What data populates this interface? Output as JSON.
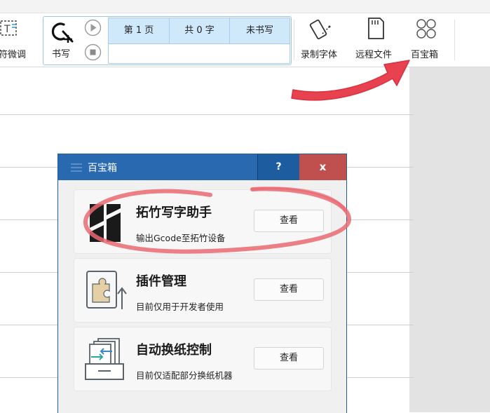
{
  "toolbar": {
    "fine_tune_label": "符微调",
    "write_label": "书写",
    "info": {
      "page": "第 1 页",
      "total": "共 0 字",
      "status": "未书写"
    },
    "record_font_label": "录制字体",
    "remote_file_label": "远程文件",
    "toolbox_label": "百宝箱"
  },
  "dialog": {
    "title": "百宝箱",
    "help_label": "?",
    "close_label": "x",
    "cards": [
      {
        "title": "拓竹写字助手",
        "desc": "输出Gcode至拓竹设备",
        "button": "查看"
      },
      {
        "title": "插件管理",
        "desc": "目前仅用于开发者使用",
        "button": "查看"
      },
      {
        "title": "自动换纸控制",
        "desc": "目前仅适配部分换纸机器",
        "button": "查看"
      }
    ]
  },
  "colors": {
    "annotation_red": "#e8414f",
    "title_bar": "#2869b0",
    "close_button": "#c0504d",
    "info_row_bg": "#cfe8fa"
  },
  "icons": [
    "text-adjust-icon",
    "write-pen-icon",
    "play-icon",
    "stop-icon",
    "phone-pen-icon",
    "sd-card-icon",
    "four-circles-icon",
    "bambu-logo-icon",
    "puzzle-icon",
    "paper-swap-icon"
  ]
}
